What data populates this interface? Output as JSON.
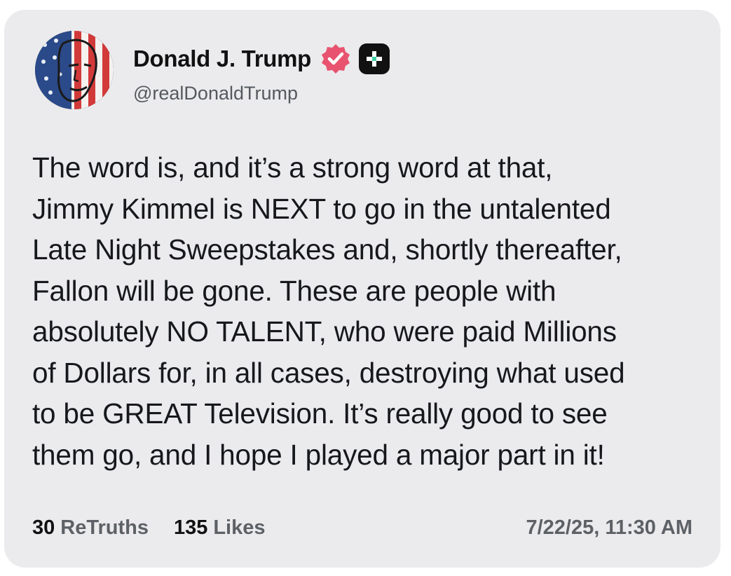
{
  "post": {
    "author": {
      "display_name": "Donald J. Trump",
      "handle": "@realDonaldTrump",
      "verified": true
    },
    "text": "The word is, and it’s a strong word at that,\nJimmy Kimmel is NEXT to go in the untalented\nLate Night Sweepstakes and, shortly thereafter,\nFallon will be gone. These are people with\nabsolutely NO TALENT, who were paid Millions\nof Dollars for, in all cases, destroying what used\nto be GREAT Television. It’s really good to see\nthem go, and I hope I played a major part in it!",
    "stats": {
      "retruths_count": "30",
      "retruths_label": "ReTruths",
      "likes_count": "135",
      "likes_label": "Likes"
    },
    "timestamp": "7/22/25, 11:30 AM"
  },
  "icons": {
    "verified": "verified-badge-icon",
    "plus": "plus-subscription-icon",
    "avatar": "avatar-image"
  },
  "colors": {
    "card_background": "#ebebed",
    "verified_badge": "#e8546f",
    "text_primary": "#16181b",
    "text_secondary": "#5d6166"
  }
}
